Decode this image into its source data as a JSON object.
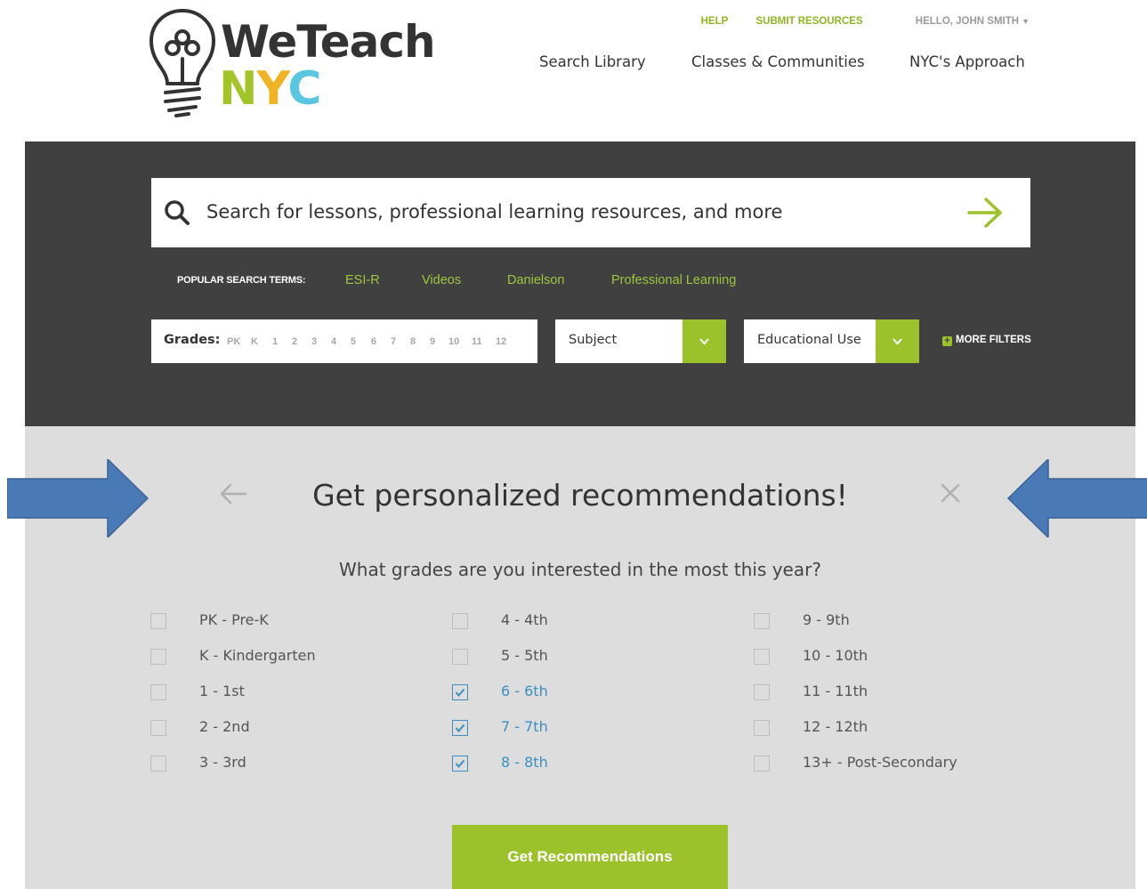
{
  "logo": {
    "word_we": "WeTeach",
    "nyc_n": "N",
    "nyc_y": "Y",
    "nyc_c": "C"
  },
  "top_links": {
    "help": "HELP",
    "submit": "SUBMIT RESOURCES",
    "user": "HELLO, JOHN SMITH"
  },
  "main_nav": {
    "search_library": "Search Library",
    "classes": "Classes & Communities",
    "approach": "NYC's Approach"
  },
  "search": {
    "placeholder": "Search for lessons, professional learning resources, and more",
    "popular_label": "POPULAR SEARCH TERMS:",
    "popular_terms": [
      "ESI-R",
      "Videos",
      "Danielson",
      "Professional Learning"
    ]
  },
  "filters": {
    "grades_label": "Grades:",
    "grade_options": [
      "PK",
      "K",
      "1",
      "2",
      "3",
      "4",
      "5",
      "6",
      "7",
      "8",
      "9",
      "10",
      "11",
      "12"
    ],
    "subject_label": "Subject",
    "educational_use_label": "Educational Use",
    "more_filters": "MORE FILTERS"
  },
  "recommendations": {
    "title": "Get personalized recommendations!",
    "question": "What grades are you interested in the most this year?",
    "columns": [
      [
        {
          "label": "PK - Pre-K",
          "checked": false
        },
        {
          "label": "K - Kindergarten",
          "checked": false
        },
        {
          "label": "1 - 1st",
          "checked": false
        },
        {
          "label": "2 - 2nd",
          "checked": false
        },
        {
          "label": "3 - 3rd",
          "checked": false
        }
      ],
      [
        {
          "label": "4 - 4th",
          "checked": false
        },
        {
          "label": "5 - 5th",
          "checked": false
        },
        {
          "label": "6 - 6th",
          "checked": true
        },
        {
          "label": "7 - 7th",
          "checked": true
        },
        {
          "label": "8 - 8th",
          "checked": true
        }
      ],
      [
        {
          "label": "9 - 9th",
          "checked": false
        },
        {
          "label": "10 - 10th",
          "checked": false
        },
        {
          "label": "11 - 11th",
          "checked": false
        },
        {
          "label": "12 - 12th",
          "checked": false
        },
        {
          "label": "13+ - Post-Secondary",
          "checked": false
        }
      ]
    ],
    "button_label": "Get Recommendations"
  },
  "colors": {
    "brand_green": "#9cc22b",
    "panel_dark": "#404040",
    "panel_light": "#dddddd",
    "checked_blue": "#3b8fc1",
    "annotation_arrow": "#4a7ab5"
  },
  "icons": {
    "logo_icon": "lightbulb-icon",
    "search_icon": "search-icon",
    "submit_icon": "arrow-right-icon",
    "back_icon": "arrow-left-icon",
    "close_icon": "close-icon",
    "dropdown_icon": "chevron-down-icon",
    "more_filters_icon": "plus-icon"
  }
}
